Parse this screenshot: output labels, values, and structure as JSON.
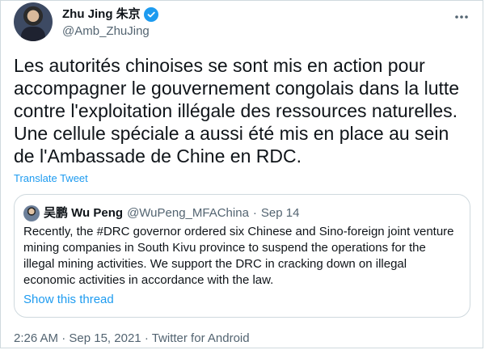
{
  "author": {
    "name": "Zhu Jing 朱京",
    "handle": "@Amb_ZhuJing",
    "verified": true
  },
  "tweet": {
    "text": "Les autorités chinoises se sont mis en action pour accompagner le gouvernement congolais dans la lutte contre l'exploitation illégale des ressources naturelles. Une cellule spéciale a aussi été mis en place au sein de l'Ambassade de Chine en RDC.",
    "translate_label": "Translate Tweet"
  },
  "quoted_tweet": {
    "display_name": "吴鹏 Wu Peng",
    "handle": "@WuPeng_MFAChina",
    "separator": "·",
    "date": "Sep 14",
    "text": "Recently, the #DRC governor ordered six Chinese and Sino-foreign joint venture mining companies in South Kivu province to suspend the operations for the illegal mining activities. We support the DRC in cracking down on illegal economic activities in accordance with the law.",
    "show_thread_label": "Show this thread"
  },
  "meta": {
    "time": "2:26 AM",
    "separator1": "·",
    "date": "Sep 15, 2021",
    "separator2": "·",
    "source": "Twitter for Android"
  },
  "colors": {
    "accent": "#1d9bf0",
    "text": "#0f1419",
    "muted": "#536471",
    "border": "#cfd9de"
  },
  "icons": {
    "verified": "verified-badge-icon",
    "more": "more-options-icon"
  }
}
